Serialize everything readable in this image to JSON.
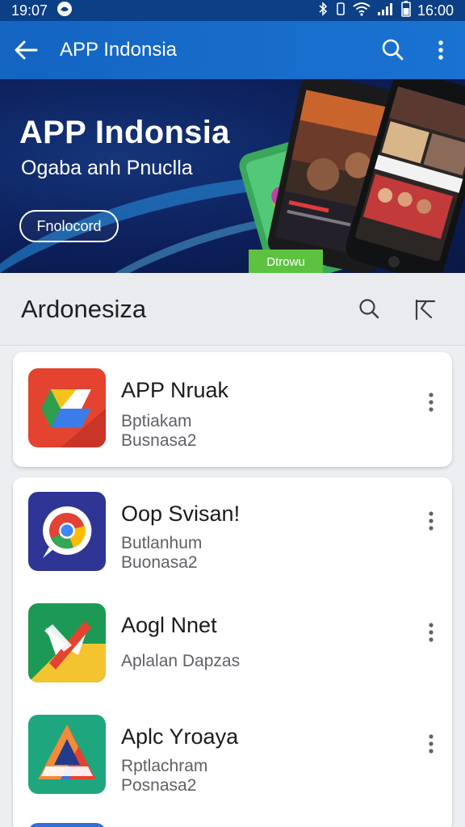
{
  "status_bar": {
    "time_left": "19:07",
    "time_right": "16:00"
  },
  "app_bar": {
    "title": "APP Indonsia"
  },
  "banner": {
    "title": "APP Indonsia",
    "subtitle": "Ogaba anh Pnuclla",
    "button_label": "Fnolocord",
    "tag_label": "Dtrowu"
  },
  "section": {
    "title": "Ardonesiza"
  },
  "apps": [
    {
      "name": "APP Nruak",
      "line1": "Bptiakam",
      "line2": "Busnasa2",
      "icon": "google-drive-style-icon"
    },
    {
      "name": "Oop Svisan!",
      "line1": "Butlanhum",
      "line2": "Buonasa2",
      "icon": "chrome-chat-icon"
    },
    {
      "name": "Aogl Nnet",
      "line1": "Aplalan Dapzas",
      "line2": "",
      "icon": "red-x-icon"
    },
    {
      "name": "Aplc Yroaya",
      "line1": "Rptlachram",
      "line2": "Posnasa2",
      "icon": "blue-play-triangle-icon"
    }
  ],
  "colors": {
    "app_bar": "#1a73d1",
    "status_bar": "#0b3f86",
    "banner_bg": "#0c1f5a",
    "accent_green": "#5cc23f"
  }
}
